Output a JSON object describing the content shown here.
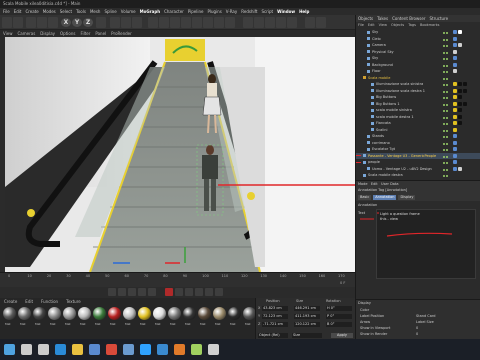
{
  "window": {
    "title": "Scala Mobile xilea0ditisia.c4d *] - Main"
  },
  "menubar": [
    "File",
    "Edit",
    "Create",
    "Modes",
    "Select",
    "Tools",
    "Mesh",
    "Spline",
    "Volume",
    "MoGraph",
    "Character",
    "Pipeline",
    "Plugins",
    "V-Ray",
    "Redshift",
    "Script",
    "Window",
    "Help"
  ],
  "toolbar": {
    "axis": [
      "X",
      "Y",
      "Z"
    ]
  },
  "viewmenu": [
    "View",
    "Cameras",
    "Display",
    "Options",
    "Filter",
    "Panel",
    "ProRender"
  ],
  "timeline": {
    "ticks": [
      "0",
      "10",
      "20",
      "30",
      "40",
      "50",
      "60",
      "70",
      "80",
      "90",
      "100",
      "110",
      "120",
      "130",
      "140",
      "150",
      "160",
      "170"
    ],
    "end": "0 F"
  },
  "materials": {
    "menu": [
      "Create",
      "Edit",
      "Function",
      "Texture"
    ],
    "swatches": [
      {
        "name": "Mat",
        "color": "#5a5a5a"
      },
      {
        "name": "Mat",
        "color": "#6b6b6b"
      },
      {
        "name": "Mat",
        "color": "#444444"
      },
      {
        "name": "Mat",
        "color": "#8a8a8a"
      },
      {
        "name": "Mat",
        "color": "#9a9a9a"
      },
      {
        "name": "Mat",
        "color": "#bbbbbb"
      },
      {
        "name": "Mat",
        "color": "#3a7a3a"
      },
      {
        "name": "Mat",
        "color": "#b82020"
      },
      {
        "name": "Mat",
        "color": "#c0c0c0"
      },
      {
        "name": "Mat",
        "color": "#e0c020"
      },
      {
        "name": "Mat",
        "color": "#dddddd"
      },
      {
        "name": "Mat",
        "color": "#777777"
      },
      {
        "name": "Mat",
        "color": "#333333"
      },
      {
        "name": "Mat",
        "color": "#5a4a3a"
      },
      {
        "name": "Mat",
        "color": "#9a8a6a"
      },
      {
        "name": "Mat",
        "color": "#2a2a2a"
      },
      {
        "name": "Mat",
        "color": "#555555"
      }
    ]
  },
  "coords": {
    "headers": [
      "Position",
      "Size",
      "Rotation"
    ],
    "rows": [
      {
        "axis": "X",
        "pos": "43.823 cm",
        "size": "446.291 cm",
        "rot": "H 0°"
      },
      {
        "axis": "Y",
        "pos": "72.123 cm",
        "size": "411.193 cm",
        "rot": "P 0°"
      },
      {
        "axis": "Z",
        "pos": "-71.721 cm",
        "size": "120.122 cm",
        "rot": "B 0°"
      }
    ],
    "mode": "Object (Rel)",
    "size_mode": "Size",
    "apply": "Apply"
  },
  "objects": {
    "tabs": [
      "Objects",
      "Takes",
      "Content Browser",
      "Structure"
    ],
    "menu": [
      "File",
      "Edit",
      "View",
      "Objects",
      "Tags",
      "Bookmarks"
    ],
    "rows": [
      {
        "name": "Sky",
        "indent": 2,
        "tags": [
          "#5a8ad0",
          "#ffffff"
        ]
      },
      {
        "name": "Cielo",
        "indent": 2,
        "tags": [
          "#5a8ad0"
        ]
      },
      {
        "name": "Camera",
        "indent": 2,
        "tags": [
          "#5a8ad0",
          "#d0d0d0"
        ]
      },
      {
        "name": "Physical Sky",
        "indent": 2,
        "tags": [
          "#d0d0d0"
        ]
      },
      {
        "name": "Sky",
        "indent": 2,
        "tags": [
          "#5a8ad0"
        ]
      },
      {
        "name": "Background",
        "indent": 2,
        "tags": [
          "#5a8ad0"
        ]
      },
      {
        "name": "Floor",
        "indent": 2,
        "tags": [
          "#d0d0d0"
        ]
      },
      {
        "name": "Scala mobile",
        "indent": 1,
        "tags": [],
        "group": true
      },
      {
        "name": "Illuminazione scala sinistra",
        "indent": 3,
        "tags": [
          "#e0c020",
          "#111111",
          "#111111"
        ]
      },
      {
        "name": "Illuminazione scala destra 1",
        "indent": 3,
        "tags": [
          "#e0c020",
          "#111111",
          "#111111"
        ]
      },
      {
        "name": "Big Buttons",
        "indent": 3,
        "tags": [
          "#e0c020",
          "#111111"
        ]
      },
      {
        "name": "Big Buttons 1",
        "indent": 3,
        "tags": [
          "#e0c020",
          "#111111",
          "#111111"
        ]
      },
      {
        "name": "scala mobile sinistra",
        "indent": 3,
        "tags": [
          "#e0c020",
          "#111111"
        ]
      },
      {
        "name": "scala mobile destra 1",
        "indent": 3,
        "tags": [
          "#e0c020",
          "#111111"
        ]
      },
      {
        "name": "Fiancata",
        "indent": 3,
        "tags": [
          "#e0c020",
          "#111111"
        ]
      },
      {
        "name": "Scalini",
        "indent": 3,
        "tags": [
          "#e0c020"
        ]
      },
      {
        "name": "Stands",
        "indent": 2,
        "tags": [
          "#5a8ad0"
        ]
      },
      {
        "name": "corrimano",
        "indent": 2,
        "tags": [
          "#5a8ad0"
        ]
      },
      {
        "name": "Escalator Tgt",
        "indent": 2,
        "tags": [
          "#5a8ad0"
        ]
      },
      {
        "name": "Passante - Ventage U3 - GenericPeople",
        "indent": 1,
        "tags": [
          "#5a8ad0"
        ],
        "selected": true,
        "marked": true
      },
      {
        "name": "people",
        "indent": 1,
        "tags": [
          "#5a8ad0"
        ],
        "marked": true
      },
      {
        "name": "Uomo - Ventage U2 - u8V2 Design",
        "indent": 2,
        "tags": [
          "#5a8ad0",
          "#d0d0d0"
        ]
      },
      {
        "name": "Scala mobile destra",
        "indent": 1,
        "tags": []
      }
    ]
  },
  "attributes": {
    "menu": [
      "Mode",
      "Edit",
      "User Data"
    ],
    "object_line": "Annotation Tag [Annotation]",
    "tabs": [
      "Basic",
      "Annotation",
      "Display"
    ],
    "active_tab": "Annotation",
    "section": "Annotation",
    "text_label": "Text",
    "text_lines": [
      "Light a question frame",
      "this - view"
    ]
  },
  "display": {
    "title": "Display",
    "rows": [
      {
        "label": "Color",
        "value": ""
      },
      {
        "label": "Label Position",
        "value": "Stand Card"
      },
      {
        "label": "Arrow",
        "value": "Label Size"
      },
      {
        "label": "Show in Viewport",
        "value": "0"
      },
      {
        "label": "Show in Render",
        "value": "0"
      }
    ]
  },
  "taskbar": {
    "icons": [
      {
        "name": "windows",
        "color": "#4fa3e0"
      },
      {
        "name": "search",
        "color": "#cccccc"
      },
      {
        "name": "taskview",
        "color": "#cccccc"
      },
      {
        "name": "edge",
        "color": "#2a8bd8"
      },
      {
        "name": "explorer",
        "color": "#e8c040"
      },
      {
        "name": "store",
        "color": "#5a8ad0"
      },
      {
        "name": "chrome",
        "color": "#d84a3a"
      },
      {
        "name": "c4d",
        "color": "#6a9ad0"
      },
      {
        "name": "photoshop",
        "color": "#2fa2ff"
      },
      {
        "name": "mail",
        "color": "#3a8ad0"
      },
      {
        "name": "mediaplayer",
        "color": "#e07a2a"
      },
      {
        "name": "app",
        "color": "#a0d060"
      },
      {
        "name": "app2",
        "color": "#d0d0d0"
      }
    ]
  },
  "colors": {
    "accent": "#5d7fb3",
    "annotation_red": "#e0262a",
    "escalator_yellow": "#e8d030"
  }
}
